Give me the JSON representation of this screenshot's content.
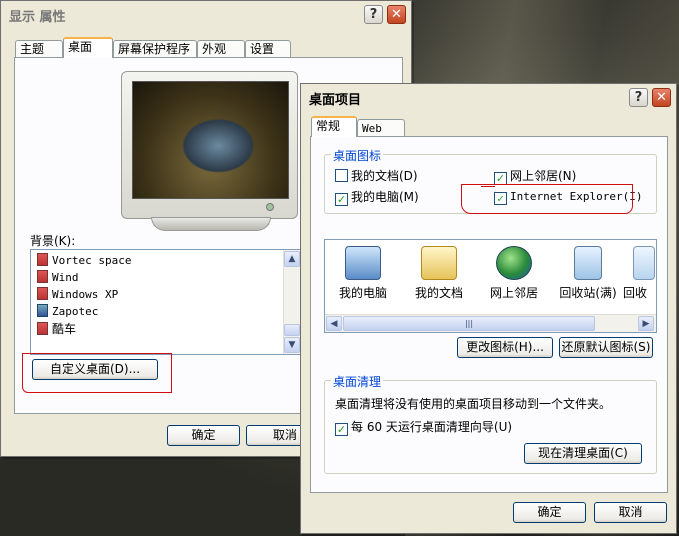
{
  "display_window": {
    "title": "显示 属性",
    "tabs": [
      "主题",
      "桌面",
      "屏幕保护程序",
      "外观",
      "设置"
    ],
    "active_tab": "桌面",
    "background_label": "背景(K):",
    "backgrounds": [
      "Vortec space",
      "Wind",
      "Windows XP",
      "Zapotec",
      "酷车"
    ],
    "customize_button": "自定义桌面(D)...",
    "ok_button": "确定",
    "cancel_button": "取消",
    "help_glyph": "?",
    "close_glyph": "✕"
  },
  "desktop_items_window": {
    "title": "桌面项目",
    "tabs": [
      "常规",
      "Web"
    ],
    "active_tab": "常规",
    "icons_group_title": "桌面图标",
    "checkboxes": [
      {
        "label": "我的文档(D)",
        "checked": false
      },
      {
        "label": "网上邻居(N)",
        "checked": true
      },
      {
        "label": "我的电脑(M)",
        "checked": true
      },
      {
        "label": "Internet Explorer(I)",
        "checked": true
      }
    ],
    "icon_items": [
      "我的电脑",
      "我的文档",
      "网上邻居",
      "回收站(满)",
      "回收"
    ],
    "change_icon_button": "更改图标(H)...",
    "restore_default_button": "还原默认图标(S)",
    "cleanup_group_title": "桌面清理",
    "cleanup_description": "桌面清理将没有使用的桌面项目移动到一个文件夹。",
    "cleanup_checkbox": {
      "label": "每 60 天运行桌面清理向导(U)",
      "checked": true
    },
    "cleanup_now_button": "现在清理桌面(C)",
    "ok_button": "确定",
    "cancel_button": "取消",
    "help_glyph": "?",
    "close_glyph": "✕"
  },
  "colors": {
    "annotation_red": "#d01010",
    "group_title_blue": "#0046d5",
    "tab_highlight": "#f7b34a"
  }
}
